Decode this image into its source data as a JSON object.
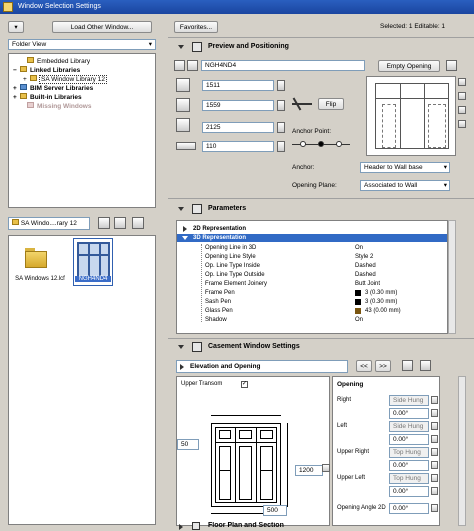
{
  "window": {
    "title": "Window Selection Settings"
  },
  "left": {
    "load_button": "Load Other Window...",
    "folder_view": "Folder View",
    "tree": [
      "Embedded Library",
      "Linked Libraries",
      "SA Window Library 12",
      "BIM Server Libraries",
      "Built-in Libraries",
      "Missing Windows"
    ],
    "path_select": "SA Windo....rary 12",
    "items": [
      {
        "label": "SA Windows 12.lcf"
      },
      {
        "label": "NGH4ND4"
      }
    ]
  },
  "header": {
    "favorites": "Favorites...",
    "selected_status": "Selected: 1 Editable: 1"
  },
  "preview": {
    "section_title": "Preview and Positioning",
    "object_name": "NGH4ND4",
    "empty_opening": "Empty Opening",
    "width": "1511",
    "height": "1559",
    "sill": "2125",
    "reveal": "110",
    "flip": "Flip",
    "anchor_point": "Anchor Point:",
    "anchor_label": "Anchor:",
    "anchor_value": "Header to Wall base",
    "opening_plane_label": "Opening Plane:",
    "opening_plane_value": "Associated to Wall"
  },
  "parameters": {
    "section_title": "Parameters",
    "rows": [
      {
        "name": "2D Representation",
        "value": "",
        "group": true
      },
      {
        "name": "3D Representation",
        "value": "",
        "group": true,
        "selected": true
      },
      {
        "name": "Opening Line in 3D",
        "value": "On"
      },
      {
        "name": "Opening Line Style",
        "value": "Style 2"
      },
      {
        "name": "Op. Line Type Inside",
        "value": "Dashed"
      },
      {
        "name": "Op. Line Type Outside",
        "value": "Dashed"
      },
      {
        "name": "Frame Element Joinery",
        "value": "Butt Joint"
      },
      {
        "name": "Frame Pen",
        "value": "3 (0.30 mm)",
        "swatch": "#000000"
      },
      {
        "name": "Sash Pen",
        "value": "3 (0.30 mm)",
        "swatch": "#000000"
      },
      {
        "name": "Glass Pen",
        "value": "43 (0.00 mm)",
        "swatch": "#7a5510"
      },
      {
        "name": "Shadow",
        "value": "On"
      }
    ]
  },
  "casement": {
    "section_title": "Casement Window Settings",
    "tab_select": "Elevation and Opening",
    "prev": "<<",
    "next": ">>",
    "upper_transom_label": "Upper Transom",
    "upper_transom_checked": "✓",
    "dim_left": "50",
    "dim_right": "1200",
    "dim_bottom": "500",
    "opening_title": "Opening",
    "right_label": "Right",
    "right_type": "Side Hung",
    "right_angle": "0.00°",
    "left_label": "Left",
    "left_type": "Side Hung",
    "left_angle": "0.00°",
    "upper_right_label": "Upper Right",
    "upper_right_type": "Top Hung",
    "upper_right_angle": "0.00°",
    "upper_left_label": "Upper Left",
    "upper_left_type": "Top Hung",
    "upper_left_angle": "0.00°",
    "opening_angle2_label": "Opening Angle 2D",
    "opening_angle2_value": "0.00°"
  },
  "floor_plan": {
    "section_title": "Floor Plan and Section"
  }
}
